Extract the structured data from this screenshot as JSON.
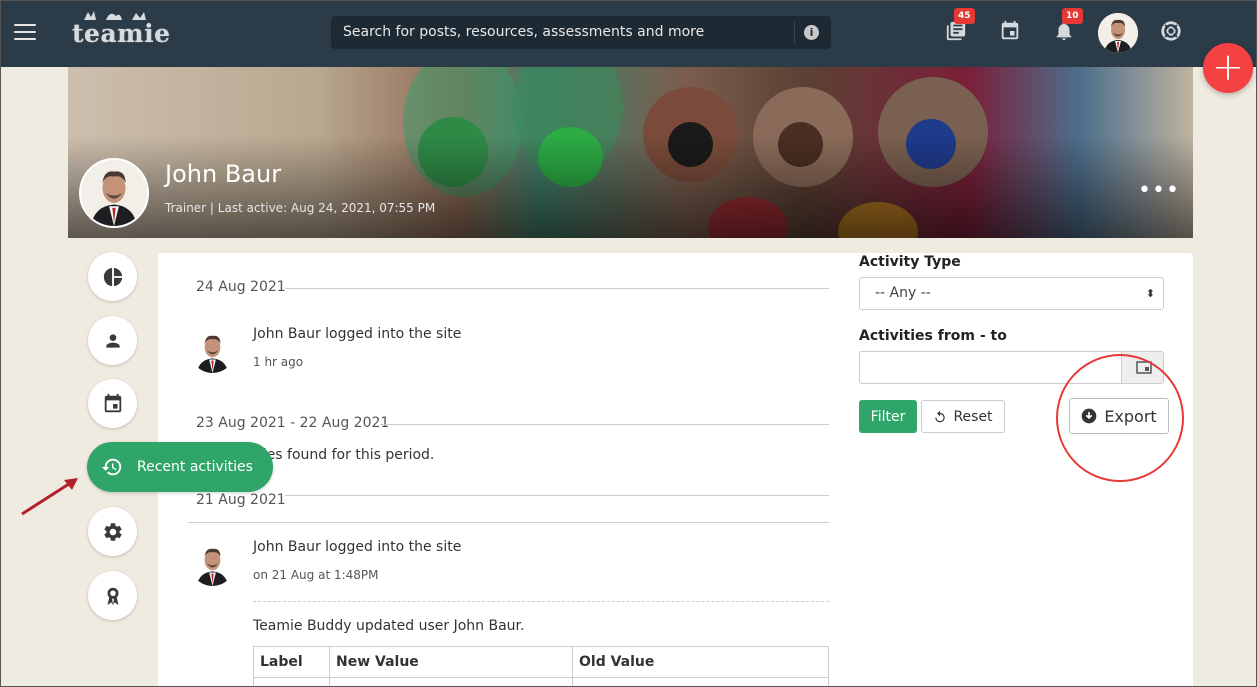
{
  "header": {
    "logo_text": "teamie",
    "search_placeholder": "Search for posts, resources, assessments and more",
    "info_icon": "info-icon",
    "library_badge": "45",
    "notifications_badge": "10"
  },
  "profile": {
    "name": "John Baur",
    "meta": "Trainer | Last active: Aug 24, 2021, 07:55 PM",
    "more": "•••"
  },
  "sidebar": {
    "items": [
      {
        "name": "dashboard",
        "icon": "pie-chart-icon"
      },
      {
        "name": "profile",
        "icon": "person-icon"
      },
      {
        "name": "calendar",
        "icon": "calendar-icon"
      },
      {
        "name": "recent-activities",
        "icon": "history-icon",
        "label": "Recent activities",
        "active": true
      },
      {
        "name": "settings",
        "icon": "gear-icon"
      },
      {
        "name": "badges",
        "icon": "award-icon"
      }
    ]
  },
  "activity": {
    "groups": [
      {
        "date": "24 Aug 2021",
        "items": [
          {
            "text": "John Baur logged into the site",
            "time": "1 hr ago"
          }
        ]
      },
      {
        "date": "23 Aug 2021 - 22 Aug 2021",
        "empty_text": "No activities found for this period."
      },
      {
        "date": "21 Aug 2021",
        "items": [
          {
            "text": "John Baur logged into the site",
            "time": "on 21 Aug at 1:48PM"
          },
          {
            "text": "Teamie Buddy updated user John Baur."
          }
        ]
      }
    ],
    "table_headers": [
      "Label",
      "New Value",
      "Old Value"
    ]
  },
  "filters": {
    "activity_type_label": "Activity Type",
    "activity_type_value": "-- Any --",
    "range_label": "Activities from - to",
    "range_value": "",
    "filter_button": "Filter",
    "reset_button": "Reset",
    "export_button": "Export"
  },
  "colors": {
    "topbar": "#2b3b48",
    "accent_green": "#2fa56a",
    "fab_red": "#f44141",
    "badge_red": "#e53935",
    "page_bg": "#f0ebe0"
  }
}
